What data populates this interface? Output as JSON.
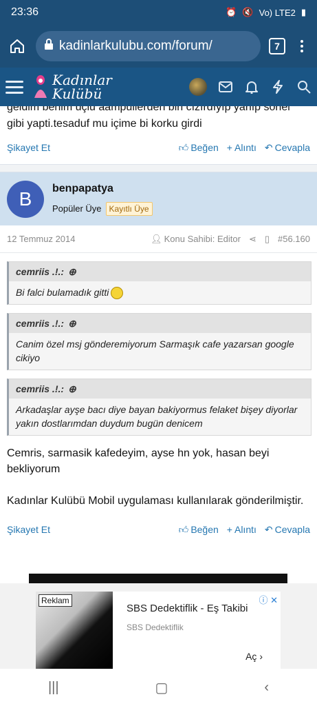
{
  "status": {
    "time": "23:36",
    "network": "Vo) LTE2"
  },
  "browser": {
    "url": "kadinlarkulubu.com/forum/",
    "tab_count": "7"
  },
  "site": {
    "logo_line1": "Kadınlar",
    "logo_line2": "Kulübü"
  },
  "post1": {
    "text_cut": "geldim benim uçlu aampullerden biri cızırdıyıp yanıp sönel",
    "text": "gibi yapti.tesaduf mu içime bi korku girdi",
    "report": "Şikayet Et",
    "like": "Beğen",
    "quote": "Alıntı",
    "reply": "Cevapla"
  },
  "post2": {
    "avatar_letter": "B",
    "username": "benpapatya",
    "role": "Popüler Üye",
    "badge": "Kayıtlı Üye",
    "date": "12 Temmuz 2014",
    "owner": "Konu Sahibi: Editor",
    "number": "#56.160",
    "quotes": [
      {
        "author": "cemriis .!.:",
        "text": "Bi falci bulamadık gitti"
      },
      {
        "author": "cemriis .!.:",
        "text": "Canim özel msj gönderemiyorum Sarmaşık cafe yazarsan google cikiyo"
      },
      {
        "author": "cemriis .!.:",
        "text": "Arkadaşlar ayşe bacı diye bayan bakiyormus felaket bişey diyorlar yakın dostlarımdan duydum bugün denicem"
      }
    ],
    "body1": "Cemris, sarmasik kafedeyim, ayse hn yok, hasan beyi bekliyorum",
    "body2": "Kadınlar Kulübü Mobil uygulaması kullanılarak gönderilmiştir.",
    "report": "Şikayet Et",
    "like": "Beğen",
    "quote": "Alıntı",
    "reply": "Cevapla"
  },
  "ad": {
    "label": "Reklam",
    "title": "SBS Dedektiflik - Eş Takibi",
    "subtitle": "SBS Dedektiflik",
    "cta": "Aç"
  }
}
